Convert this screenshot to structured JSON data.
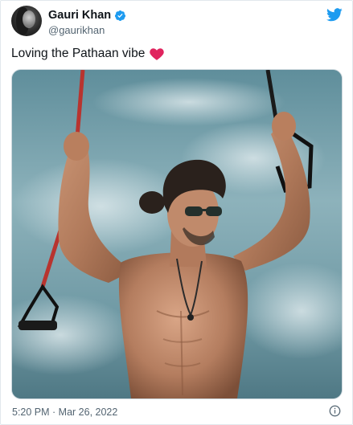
{
  "author": {
    "name": "Gauri Khan",
    "handle": "@gaurikhan"
  },
  "tweet": {
    "text": "Loving the Pathaan vibe",
    "emoji_icon": "red-heart-icon"
  },
  "footer": {
    "timestamp": "5:20 PM · Mar 26, 2022"
  },
  "icons": {
    "brand": "twitter-bird-icon",
    "verified": "verified-badge-icon",
    "info": "info-icon"
  },
  "colors": {
    "twitter_blue": "#1d9bf0",
    "heart_red": "#e0245e",
    "text_primary": "#0f1419",
    "text_secondary": "#536471",
    "border": "#e1e8ed"
  }
}
